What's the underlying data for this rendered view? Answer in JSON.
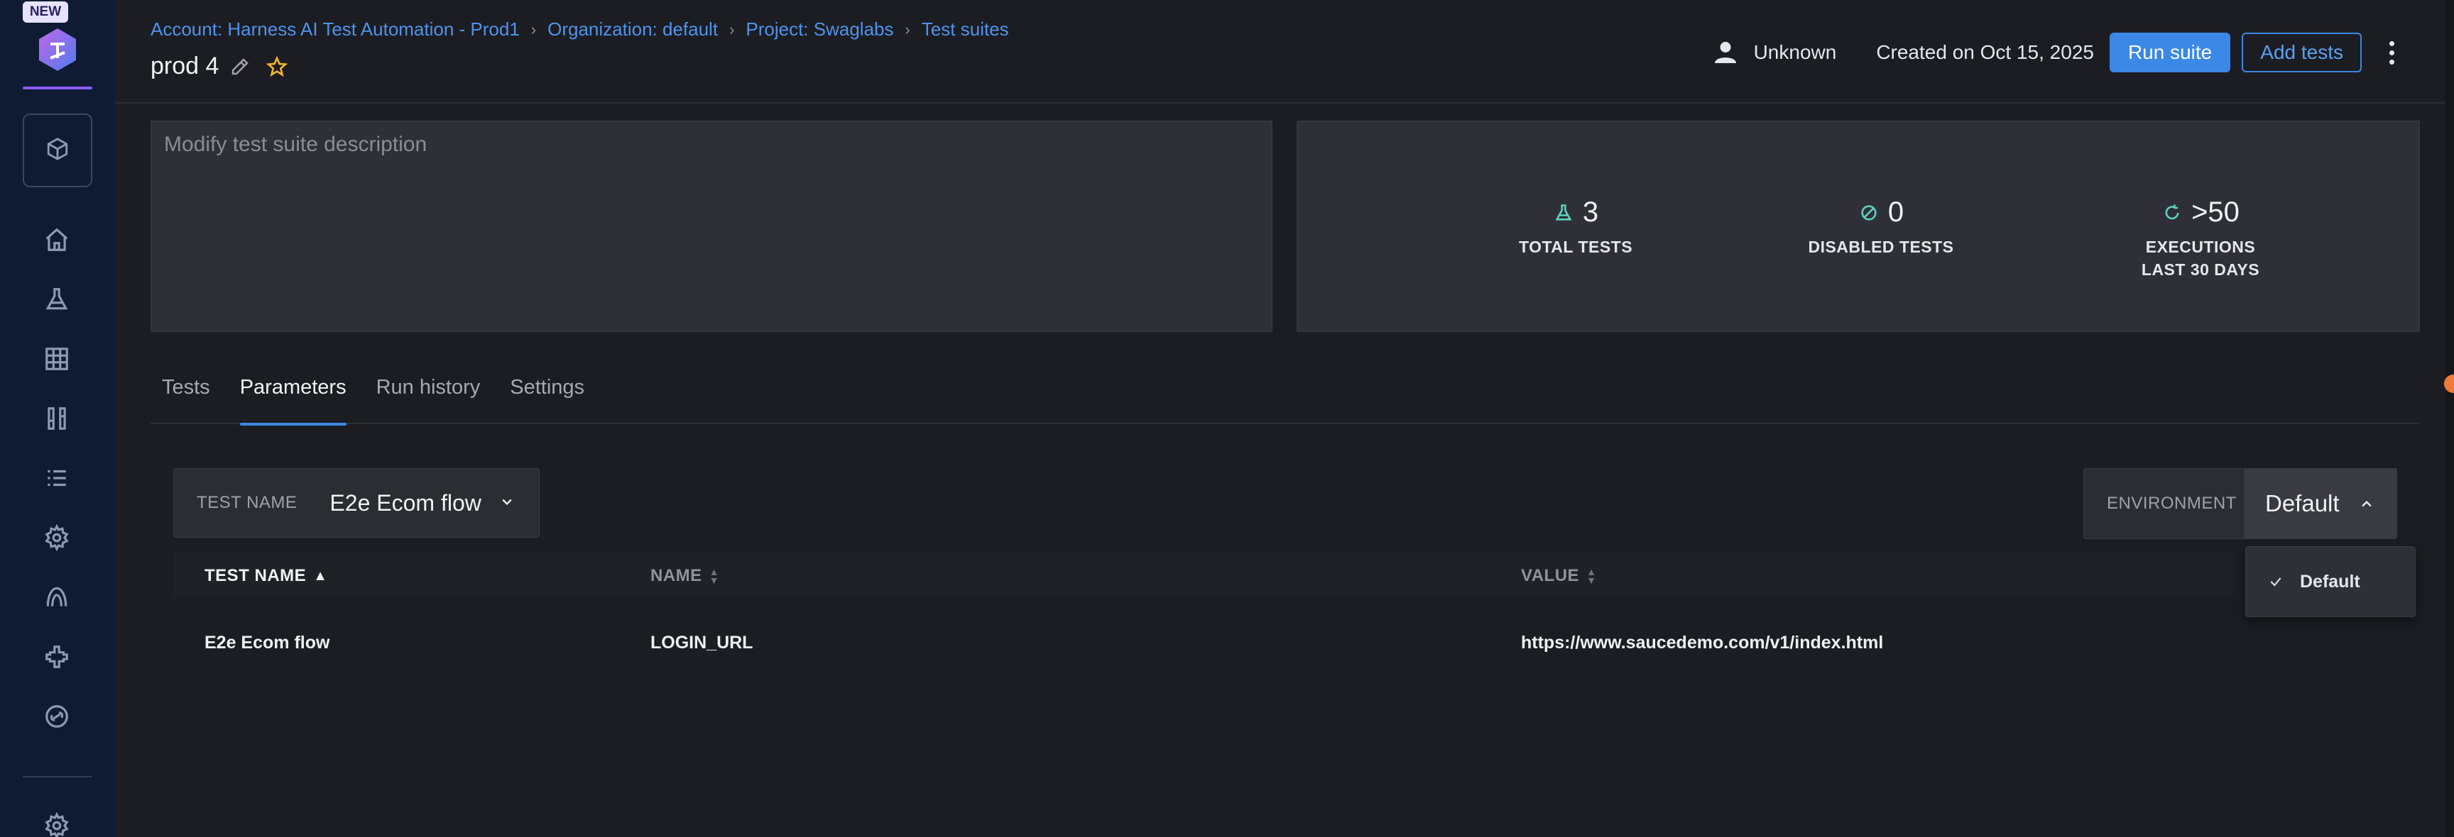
{
  "sidebar": {
    "new_badge": "NEW",
    "icons": [
      "home-icon",
      "flask-icon",
      "grid-icon",
      "columns-icon",
      "list-icon",
      "gear-icon",
      "rocket-icon",
      "puzzle-icon",
      "link-icon",
      "settings-icon"
    ]
  },
  "header": {
    "breadcrumb": [
      "Account: Harness AI Test Automation - Prod1",
      "Organization: default",
      "Project: Swaglabs",
      "Test suites"
    ],
    "title": "prod 4",
    "owner": "Unknown",
    "created": "Created on Oct 15, 2025",
    "run_suite_label": "Run suite",
    "add_tests_label": "Add tests"
  },
  "description": {
    "placeholder": "Modify test suite description"
  },
  "stats": [
    {
      "value": "3",
      "label": "TOTAL TESTS",
      "icon": "flask-icon"
    },
    {
      "value": "0",
      "label": "DISABLED TESTS",
      "icon": "disabled-icon"
    },
    {
      "value": ">50",
      "label": "EXECUTIONS",
      "label2": "LAST 30 DAYS",
      "icon": "refresh-icon"
    }
  ],
  "tabs": [
    "Tests",
    "Parameters",
    "Run history",
    "Settings"
  ],
  "active_tab": "Parameters",
  "filter": {
    "label": "TEST NAME",
    "value": "E2e Ecom flow"
  },
  "environment": {
    "label": "ENVIRONMENT",
    "value": "Default",
    "options": [
      "Default"
    ]
  },
  "table": {
    "columns": [
      "TEST NAME",
      "NAME",
      "VALUE"
    ],
    "rows": [
      {
        "test_name": "E2e Ecom flow",
        "name": "LOGIN_URL",
        "value": "https://www.saucedemo.com/v1/index.html"
      }
    ]
  },
  "colors": {
    "accent": "#3b88e6",
    "sidebar": "#0f1b33",
    "background": "#1c1d22",
    "stat_icon": "#5fd1c0"
  }
}
